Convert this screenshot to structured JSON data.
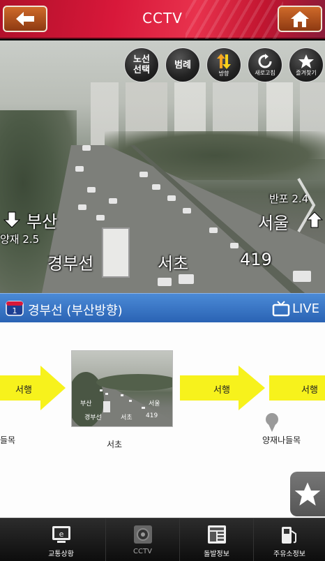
{
  "header": {
    "title": "CCTV",
    "back_icon": "back-arrow-icon",
    "home_icon": "home-icon"
  },
  "camera": {
    "buttons": [
      {
        "label": "노선\n선택",
        "icon": "route-select"
      },
      {
        "label": "범례",
        "icon": "legend"
      },
      {
        "label": "방향",
        "icon": "direction-arrows-icon"
      },
      {
        "label": "새로고침",
        "icon": "refresh-icon"
      },
      {
        "label": "즐겨찾기",
        "icon": "star-icon"
      }
    ],
    "overlay": {
      "left_dest": "부산",
      "left_sub": "양재 2.5",
      "right_dest": "서울",
      "right_sub": "반포 2.4",
      "route_name": "경부선",
      "location": "서초",
      "number": "419"
    }
  },
  "route_bar": {
    "shield_number": "1",
    "route_title": "경부선 (부산방향)",
    "live_label": "LIVE"
  },
  "diagram": {
    "arrow_labels": [
      "서행",
      "서행",
      "서행"
    ],
    "nodes": [
      {
        "label": "들목"
      },
      {
        "label": "서초"
      },
      {
        "label": "양재나들목"
      }
    ],
    "thumb_overlay": {
      "left_dest": "부산",
      "right_dest": "서울",
      "route_name": "경부선",
      "location": "서초",
      "number": "419"
    },
    "arrow_color": "#f7f21c"
  },
  "bottom_nav": {
    "items": [
      {
        "label": "교통상황",
        "icon": "traffic-status-icon"
      },
      {
        "label": "CCTV",
        "icon": "cctv-camera-icon"
      },
      {
        "label": "돌발정보",
        "icon": "incident-info-icon"
      },
      {
        "label": "주유소정보",
        "icon": "gas-station-icon"
      }
    ]
  },
  "colors": {
    "header_red": "#d8183a",
    "route_bar_blue": "#3a78c8",
    "slow_yellow": "#f7f21c"
  }
}
